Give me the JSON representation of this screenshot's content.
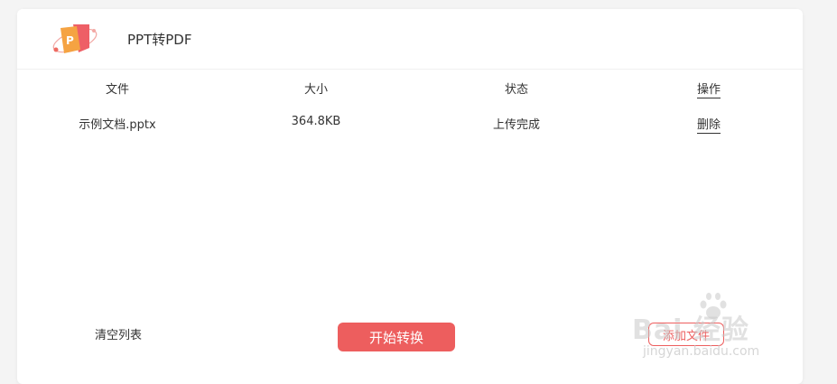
{
  "header": {
    "title": "PPT转PDF",
    "logo_icon": "ppt-to-pdf-logo-icon"
  },
  "table": {
    "columns": [
      "文件",
      "大小",
      "状态",
      "操作"
    ],
    "rows": [
      {
        "file": "示例文档.pptx",
        "size": "364.8KB",
        "status": "上传完成",
        "action": "删除"
      }
    ]
  },
  "footer": {
    "clear_label": "清空列表",
    "start_label": "开始转换",
    "add_label": "添加文件"
  },
  "watermark": {
    "brand": "Bai 经验",
    "url": "jingyan.baidu.com"
  },
  "colors": {
    "accent": "#ed5e5e",
    "background": "#f4f4f4",
    "card": "#ffffff"
  }
}
